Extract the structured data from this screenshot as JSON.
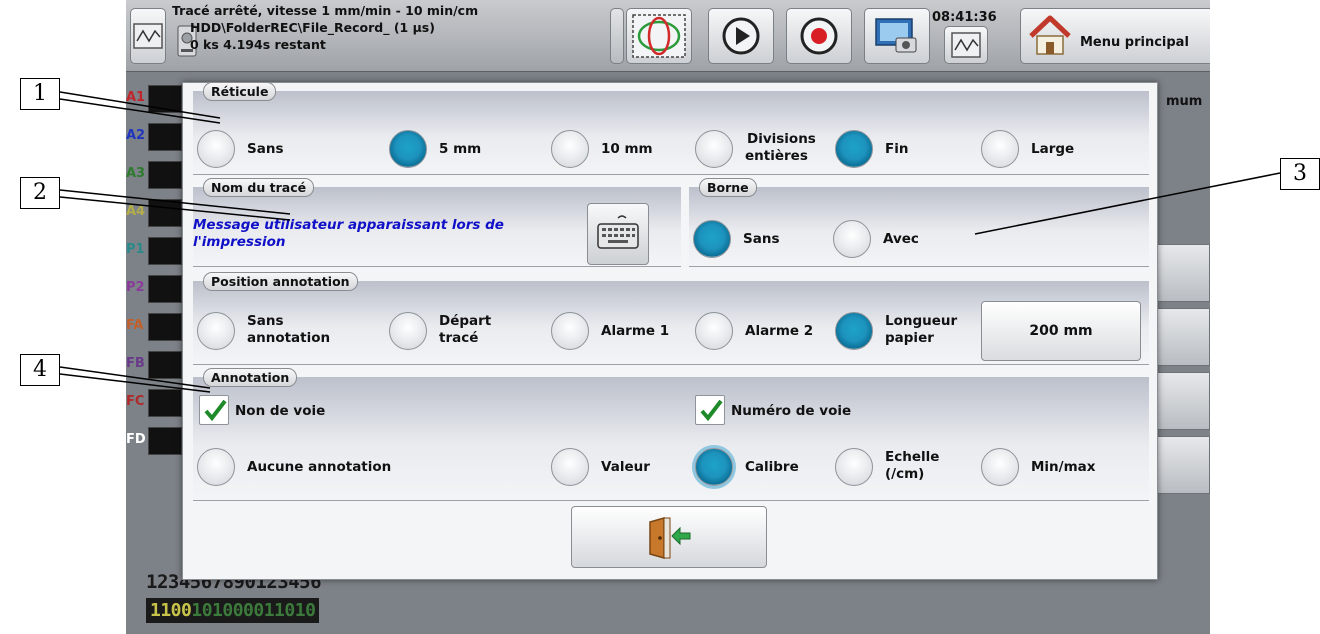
{
  "topbar": {
    "status_line1": "Tracé arrêté, vitesse 1 mm/min - 10 min/cm",
    "status_line2": "HDD\\FolderREC\\File_Record_ (1 µs)",
    "status_line3": "0 ks 4.194s restant",
    "clock": "08:41:36",
    "menu_label": "Menu principal"
  },
  "channels": [
    {
      "label": "A1",
      "color": "#c0262c"
    },
    {
      "label": "A2",
      "color": "#2036c0"
    },
    {
      "label": "A3",
      "color": "#2e7a2e"
    },
    {
      "label": "A4",
      "color": "#b3ad4a"
    },
    {
      "label": "P1",
      "color": "#2a8a8a"
    },
    {
      "label": "P2",
      "color": "#8a3a9a"
    },
    {
      "label": "FA",
      "color": "#c0602a"
    },
    {
      "label": "FB",
      "color": "#6a3a8a"
    },
    {
      "label": "FC",
      "color": "#b02a2a"
    },
    {
      "label": "FD",
      "color": "#ffffff"
    }
  ],
  "bottom": {
    "digits": "1234567890123456",
    "binary_a": "1100",
    "binary_b": "101000011010"
  },
  "right_partial": "mum",
  "reticule": {
    "title": "Réticule",
    "options": [
      {
        "label": "Sans",
        "selected": false
      },
      {
        "label": "5 mm",
        "selected": true
      },
      {
        "label": "10 mm",
        "selected": false
      },
      {
        "label_l1": "Divisions",
        "label_l2": "entières",
        "selected": false
      },
      {
        "label": "Fin",
        "selected": true
      },
      {
        "label": "Large",
        "selected": false
      }
    ]
  },
  "nom_trace": {
    "title": "Nom du tracé",
    "message_l1": "Message utilisateur apparaissant lors de",
    "message_l2": "l'impression"
  },
  "borne": {
    "title": "Borne",
    "options": [
      {
        "label": "Sans",
        "selected": true
      },
      {
        "label": "Avec",
        "selected": false
      }
    ]
  },
  "position_annotation": {
    "title": "Position annotation",
    "options": [
      {
        "label_l1": "Sans",
        "label_l2": "annotation",
        "selected": false
      },
      {
        "label_l1": "Départ",
        "label_l2": "tracé",
        "selected": false
      },
      {
        "label": "Alarme 1",
        "selected": false
      },
      {
        "label": "Alarme 2",
        "selected": false
      },
      {
        "label_l1": "Longueur",
        "label_l2": "papier",
        "selected": true
      }
    ],
    "length_value": "200 mm"
  },
  "annotation": {
    "title": "Annotation",
    "checkbox_1": {
      "label": "Non de voie",
      "checked": true
    },
    "checkbox_2": {
      "label": "Numéro de voie",
      "checked": true
    },
    "options": [
      {
        "label": "Aucune annotation",
        "selected": false
      },
      {
        "label": "Valeur",
        "selected": false
      },
      {
        "label": "Calibre",
        "selected": true
      },
      {
        "label_l1": "Echelle",
        "label_l2": "(/cm)",
        "selected": false
      },
      {
        "label": "Min/max",
        "selected": false
      }
    ]
  },
  "callouts": [
    "1",
    "2",
    "3",
    "4"
  ],
  "icons": {
    "display_mode": "waveform-icon",
    "disk": "hdd-icon",
    "xy_mode": "lissajous-icon",
    "play": "play-icon",
    "record": "record-icon",
    "screenshot": "screenshot-icon",
    "home": "home-icon",
    "keyboard": "keyboard-icon",
    "exit": "exit-door-icon"
  },
  "colors": {
    "radio_selected": "#1a8fbd",
    "message_text": "#1010c8",
    "record_red": "#d81f26",
    "check_green": "#1f8a2a"
  }
}
